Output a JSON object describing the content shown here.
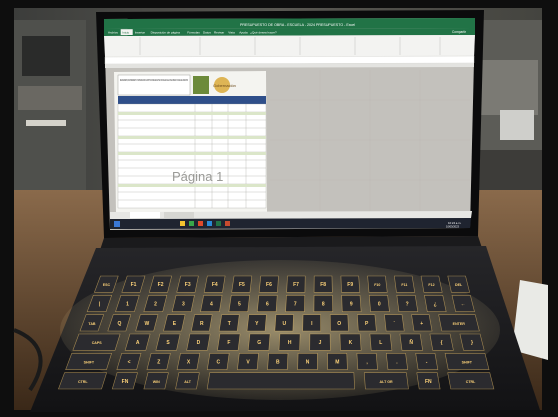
{
  "scene": {
    "kind": "photo of a gaming laptop on a desk showing an Excel spreadsheet",
    "colors": {
      "frame": "#111111",
      "ribbon_green": "#217346",
      "screen_grey": "#c4c2bd",
      "key_glow": "#ffd47a",
      "wood": "#6a4a2e"
    }
  },
  "excel": {
    "title": "PRESUPUESTO DE OBRA - ESCUELA - 2024 PRESUPUESTO - Excel",
    "tabs": [
      "Archivo",
      "Inicio",
      "Insertar",
      "Disposición de página",
      "Fórmulas",
      "Datos",
      "Revisar",
      "Vista",
      "Ayuda",
      "¿Qué desea hacer?"
    ],
    "share_label": "Compartir",
    "sheet_heading": "MEJORAMIENTO, MANTENIMIENTO Y RESTAURACION DE INSTITUCIONES EDUCATIVAS OFICIALES DE LA ZONA URBANA Y RURAL DEL MUNICIPIO",
    "logo_text": "Gobernación",
    "page_watermark": "Página 1"
  },
  "taskbar": {
    "clock": "10:24 a.m.",
    "date": "10/03/2023"
  },
  "keyboard": {
    "row1": [
      "ESC",
      "F1",
      "F2",
      "F3",
      "F4",
      "F5",
      "F6",
      "F7",
      "F8",
      "F9",
      "F10",
      "F11",
      "F12",
      "DEL"
    ],
    "row2": [
      "|",
      "1",
      "2",
      "3",
      "4",
      "5",
      "6",
      "7",
      "8",
      "9",
      "0",
      "?",
      "¿",
      "←"
    ],
    "row3": [
      "TAB",
      "Q",
      "W",
      "E",
      "R",
      "T",
      "Y",
      "U",
      "I",
      "O",
      "P",
      "´",
      "+",
      "ENTER"
    ],
    "row4": [
      "CAPS",
      "A",
      "S",
      "D",
      "F",
      "G",
      "H",
      "J",
      "K",
      "L",
      "Ñ",
      "{",
      "}"
    ],
    "row5": [
      "SHIFT",
      "<",
      "Z",
      "X",
      "C",
      "V",
      "B",
      "N",
      "M",
      ",",
      ".",
      "-",
      "SHIFT"
    ],
    "row6": [
      "CTRL",
      "FN",
      "WIN",
      "ALT",
      "",
      "ALT GR",
      "FN",
      "CTRL"
    ]
  }
}
